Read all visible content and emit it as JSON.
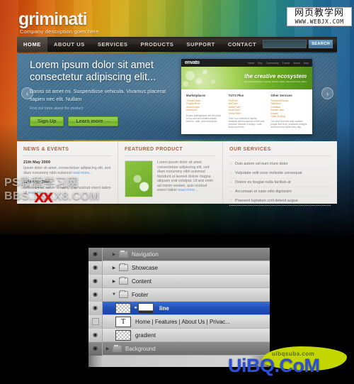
{
  "website": {
    "logo": {
      "name": "griminati",
      "tagline": "Company description goes here"
    },
    "nav": {
      "items": [
        {
          "label": "HOME",
          "active": true
        },
        {
          "label": "ABOUT US",
          "active": false
        },
        {
          "label": "SERVICES",
          "active": false
        },
        {
          "label": "PRODUCTS",
          "active": false
        },
        {
          "label": "SUPPORT",
          "active": false
        },
        {
          "label": "CONTACT",
          "active": false
        }
      ],
      "search": {
        "value": "",
        "placeholder": "",
        "button_label": "SEARCH"
      }
    },
    "showcase": {
      "title": "Lorem ipsum dolor sit amet consectetur adipiscing elit...",
      "body": "Danisi sit amet mi. Suspendisse vehicula. Vivamus placerat sapien nec elit. Nullam",
      "small": "Find out more about the product",
      "buttons": {
        "signup": "Sign Up",
        "learnmore": "Learn more",
        "arrow": "→"
      },
      "prev_arrow": "‹",
      "next_arrow": "›",
      "envato": {
        "logo": "envato",
        "nav": [
          "Home",
          "Buy",
          "Community",
          "Forum",
          "About",
          "Help"
        ],
        "tagline": "the creative ecosystem",
        "subtag": "Buy and sell photos, sounds, themes, flash, video and more online",
        "columns": [
          {
            "heading": "Marketplaces",
            "items": [
              "ThemeForest",
              "GraphicRiver",
              "AudioJungle",
              "ActiveDen"
            ],
            "paragraph": "Envato marketplaces are the place to buy and sell creative assets, themes, code, video and audio."
          },
          {
            "heading": "TUTS Plus",
            "items": [
              "PsdTuts+",
              "NetTuts+",
              "ActiveTuts+",
              "AudioTuts+",
              "VectorTuts+"
            ],
            "paragraph": "Tuts+ is a network of tutorial websites with thousands of free and premium tutorials in design, code, audio and more."
          },
          {
            "heading": "Other Services",
            "items": [
              "FreelanceSwitch",
              "FlashDen",
              "Creattica",
              "Envato Jobs",
              "Envato",
              "Collis Ta Blog"
            ],
            "paragraph": "Our other services help creative people find work, showcase designs and learn new skills every day."
          }
        ]
      }
    },
    "content": {
      "news": {
        "heading": "NEWS & EVENTS",
        "entries": [
          {
            "date": "21th May 2009",
            "text": "Ipsum dolor sit amet, consectetuer adipiscing elit, sed diam nonummy nibh euismod",
            "readmore": "read more..."
          },
          {
            "date": "17th May 2009",
            "text": "Wisi enim ad minim veniam, quis nostrud exerci tation ull",
            "readmore": "read more..."
          }
        ]
      },
      "featured": {
        "heading": "FEATURED PRODUCT",
        "text": "Lorem ipsum dolor sit amet, consectetuer adipiscing elit, sed diam nonummy nibh euismod tincidunt ut laoreet dolore magna aliquam erat volutpat. Ut wisi enim ad minim veniam, quis nostrud exerci tation",
        "readmore": "read more..."
      },
      "services": {
        "heading": "OUR SERVICES",
        "items": [
          "Duis autem vel eum iriure dolor",
          "Vulputate velit esse molestie consequat",
          "Dolore eu feugiat nulla facilisis at",
          "Accumsan et iusto odio dignissim",
          "Praesent luptatum zzril delenit augue"
        ]
      }
    }
  },
  "layers_panel": {
    "rows": [
      {
        "label": "Navigation",
        "type": "group",
        "visible": true,
        "expanded": false,
        "selected": false,
        "dim": true
      },
      {
        "label": "Showcase",
        "type": "group",
        "visible": true,
        "expanded": false,
        "selected": false,
        "dim": false
      },
      {
        "label": "Content",
        "type": "group",
        "visible": true,
        "expanded": false,
        "selected": false,
        "dim": false
      },
      {
        "label": "Footer",
        "type": "group",
        "visible": true,
        "expanded": true,
        "selected": false,
        "dim": false
      },
      {
        "label": "line",
        "type": "layer-mask",
        "visible": true,
        "expanded": false,
        "selected": true,
        "dim": false
      },
      {
        "label": "Home | Features | About Us | Privac...",
        "type": "text",
        "visible": false,
        "expanded": false,
        "selected": false,
        "dim": false,
        "glyph": "T"
      },
      {
        "label": "gradient",
        "type": "layer",
        "visible": true,
        "expanded": false,
        "selected": false,
        "dim": false
      },
      {
        "label": "Background",
        "type": "group",
        "visible": true,
        "expanded": false,
        "selected": false,
        "dim": true
      }
    ],
    "eye_glyph": "◉",
    "link_glyph": "⚭",
    "triangle_collapsed": "▶",
    "triangle_expanded": "▼"
  },
  "watermarks": {
    "topright": {
      "cn": "网页教学网",
      "url": "WWW.WEBJX.COM"
    },
    "middle": {
      "line1": "PS教程学习网",
      "line2": "BBS.16XX8.COM",
      "stamp": "XX"
    },
    "bottom": {
      "main": "UiBQ.CoM",
      "blob": "uibqsuba.com"
    }
  }
}
